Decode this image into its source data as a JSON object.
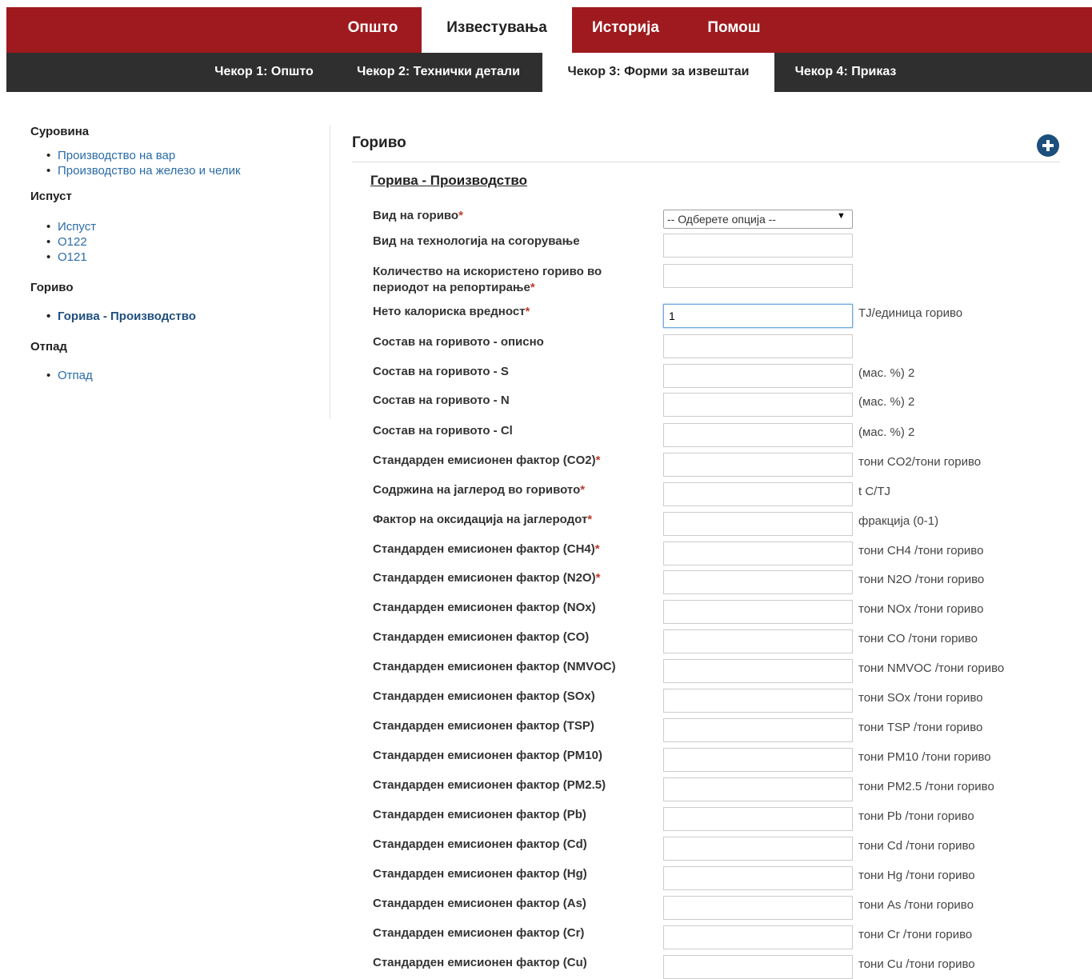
{
  "top_nav": {
    "tabs": [
      {
        "label": "Општо",
        "active": false
      },
      {
        "label": "Известувања",
        "active": true
      },
      {
        "label": "Историја",
        "active": false
      },
      {
        "label": "Помош",
        "active": false
      }
    ]
  },
  "steps": [
    {
      "label": "Чекор 1: Општо",
      "active": false
    },
    {
      "label": "Чекор 2: Технички детали",
      "active": false
    },
    {
      "label": "Чекор 3: Форми за извештаи",
      "active": true
    },
    {
      "label": "Чекор 4: Приказ",
      "active": false
    }
  ],
  "sidebar": {
    "groups": [
      {
        "title": "Суровина",
        "items": [
          "Производство на вар",
          "Производство на железо и челик"
        ]
      },
      {
        "title": "Испуст",
        "items": [
          "Испуст",
          "O122",
          "O121"
        ]
      },
      {
        "title": "Гориво",
        "items": [
          "Горива - Производство"
        ]
      },
      {
        "title": "Отпад",
        "items": [
          "Отпад"
        ]
      }
    ],
    "active_item": "Горива - Производство"
  },
  "main": {
    "section_title": "Гориво",
    "subsection_title": "Горива - Производство",
    "fields": [
      {
        "label": "Вид на гориво",
        "required": true,
        "type": "select",
        "value": "-- Одберете опција --",
        "unit": ""
      },
      {
        "label": "Вид на технологија на согорување",
        "required": false,
        "type": "text",
        "value": "",
        "unit": ""
      },
      {
        "label": "Количество на искористено гориво во периодот на репортирање",
        "required": true,
        "type": "text",
        "value": "",
        "unit": ""
      },
      {
        "label": "Нето калориска вредност",
        "required": true,
        "type": "text",
        "value": "1",
        "unit": "TJ/единица гориво"
      },
      {
        "label": "Состав на горивото - описно",
        "required": false,
        "type": "text",
        "value": "",
        "unit": ""
      },
      {
        "label": "Состав на горивото - S",
        "required": false,
        "type": "text",
        "value": "",
        "unit": "(мас. %) 2"
      },
      {
        "label": "Состав на горивото - N",
        "required": false,
        "type": "text",
        "value": "",
        "unit": "(мас. %) 2"
      },
      {
        "label": "Состав на горивото - Cl",
        "required": false,
        "type": "text",
        "value": "",
        "unit": "(мас. %) 2"
      },
      {
        "label": "Стандарден емисионен фактор (CO2)",
        "required": true,
        "type": "text",
        "value": "",
        "unit": "тони CO2/тони гориво"
      },
      {
        "label": "Содржина на јаглерод во горивото",
        "required": true,
        "type": "text",
        "value": "",
        "unit": "t C/TJ"
      },
      {
        "label": "Фактор на оксидација на јаглеродот",
        "required": true,
        "type": "text",
        "value": "",
        "unit": "фракција (0-1)"
      },
      {
        "label": "Стандарден емисионен фактор (CH4)",
        "required": true,
        "type": "text",
        "value": "",
        "unit": "тони CH4 /тони гориво"
      },
      {
        "label": "Стандарден емисионен фактор (N2O)",
        "required": true,
        "type": "text",
        "value": "",
        "unit": "тони N2O /тони гориво"
      },
      {
        "label": "Стандарден емисионен фактор (NOx)",
        "required": false,
        "type": "text",
        "value": "",
        "unit": "тони NOx /тони гориво"
      },
      {
        "label": "Стандарден емисионен фактор (CO)",
        "required": false,
        "type": "text",
        "value": "",
        "unit": "тони CO /тони гориво"
      },
      {
        "label": "Стандарден емисионен фактор (NMVOC)",
        "required": false,
        "type": "text",
        "value": "",
        "unit": "тони NMVOC /тони гориво"
      },
      {
        "label": "Стандарден емисионен фактор (SOx)",
        "required": false,
        "type": "text",
        "value": "",
        "unit": "тони SOx /тони гориво"
      },
      {
        "label": "Стандарден емисионен фактор (TSP)",
        "required": false,
        "type": "text",
        "value": "",
        "unit": "тони TSP /тони гориво"
      },
      {
        "label": "Стандарден емисионен фактор (PM10)",
        "required": false,
        "type": "text",
        "value": "",
        "unit": "тони PM10 /тони гориво"
      },
      {
        "label": "Стандарден емисионен фактор (PM2.5)",
        "required": false,
        "type": "text",
        "value": "",
        "unit": "тони PM2.5 /тони гориво"
      },
      {
        "label": "Стандарден емисионен фактор (Pb)",
        "required": false,
        "type": "text",
        "value": "",
        "unit": "тони Pb /тони гориво"
      },
      {
        "label": "Стандарден емисионен фактор (Cd)",
        "required": false,
        "type": "text",
        "value": "",
        "unit": "тони Cd /тони гориво"
      },
      {
        "label": "Стандарден емисионен фактор (Hg)",
        "required": false,
        "type": "text",
        "value": "",
        "unit": "тони Hg /тони гориво"
      },
      {
        "label": "Стандарден емисионен фактор (As)",
        "required": false,
        "type": "text",
        "value": "",
        "unit": "тони As /тони гориво"
      },
      {
        "label": "Стандарден емисионен фактор (Cr)",
        "required": false,
        "type": "text",
        "value": "",
        "unit": "тони Cr /тони гориво"
      },
      {
        "label": "Стандарден емисионен фактор (Cu)",
        "required": false,
        "type": "text",
        "value": "",
        "unit": "тони Cu /тони гориво"
      }
    ]
  },
  "colors": {
    "top_nav_bg": "#9e1a1e",
    "sub_nav_bg": "#2f2f2f",
    "link": "#2b6ca8",
    "required_asterisk": "#c0392b",
    "add_button": "#1d4f7c"
  },
  "icons": {
    "add_button": "plus-circle-icon"
  }
}
